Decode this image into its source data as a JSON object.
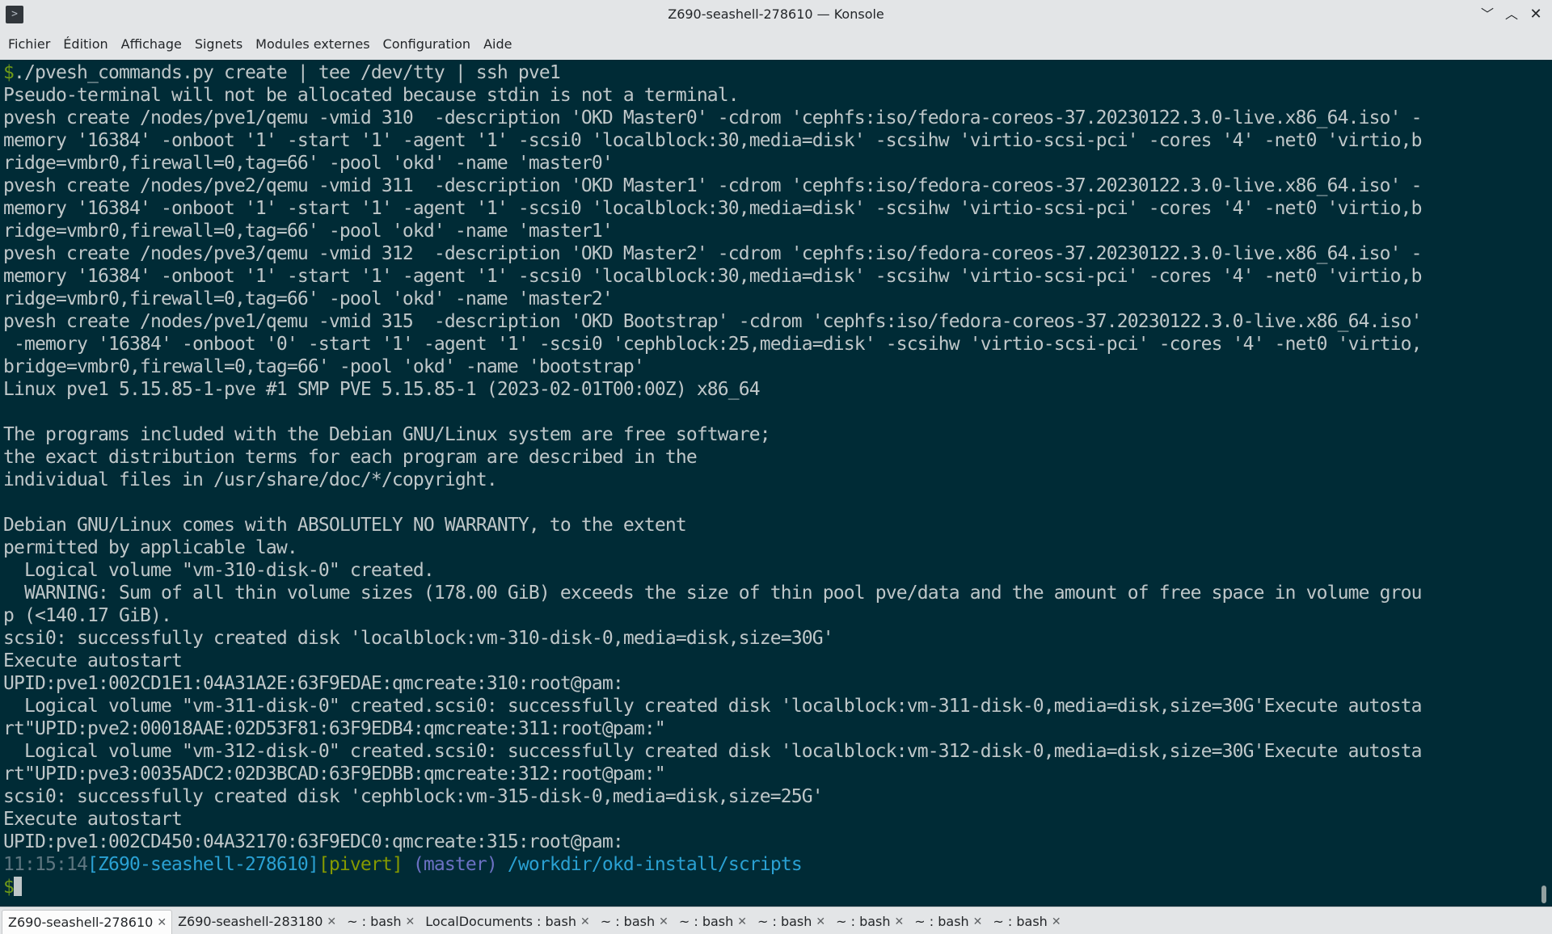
{
  "window": {
    "title": "Z690-seashell-278610 — Konsole",
    "app_icon": ">",
    "minimize_icon": "﹀",
    "maximize_icon": "︿",
    "close_icon": "✕"
  },
  "menu": [
    "Fichier",
    "Édition",
    "Affichage",
    "Signets",
    "Modules externes",
    "Configuration",
    "Aide"
  ],
  "terminal": {
    "lines": [
      [
        {
          "t": "$",
          "c": "c-green"
        },
        {
          "t": "./pvesh_commands.py create | tee /dev/tty | ssh pve1"
        }
      ],
      [
        {
          "t": "Pseudo-terminal will not be allocated because stdin is not a terminal."
        }
      ],
      [
        {
          "t": "pvesh create /nodes/pve1/qemu -vmid 310  -description 'OKD Master0' -cdrom 'cephfs:iso/fedora-coreos-37.20230122.3.0-live.x86_64.iso' -"
        }
      ],
      [
        {
          "t": "memory '16384' -onboot '1' -start '1' -agent '1' -scsi0 'localblock:30,media=disk' -scsihw 'virtio-scsi-pci' -cores '4' -net0 'virtio,b"
        }
      ],
      [
        {
          "t": "ridge=vmbr0,firewall=0,tag=66' -pool 'okd' -name 'master0'"
        }
      ],
      [
        {
          "t": "pvesh create /nodes/pve2/qemu -vmid 311  -description 'OKD Master1' -cdrom 'cephfs:iso/fedora-coreos-37.20230122.3.0-live.x86_64.iso' -"
        }
      ],
      [
        {
          "t": "memory '16384' -onboot '1' -start '1' -agent '1' -scsi0 'localblock:30,media=disk' -scsihw 'virtio-scsi-pci' -cores '4' -net0 'virtio,b"
        }
      ],
      [
        {
          "t": "ridge=vmbr0,firewall=0,tag=66' -pool 'okd' -name 'master1'"
        }
      ],
      [
        {
          "t": "pvesh create /nodes/pve3/qemu -vmid 312  -description 'OKD Master2' -cdrom 'cephfs:iso/fedora-coreos-37.20230122.3.0-live.x86_64.iso' -"
        }
      ],
      [
        {
          "t": "memory '16384' -onboot '1' -start '1' -agent '1' -scsi0 'localblock:30,media=disk' -scsihw 'virtio-scsi-pci' -cores '4' -net0 'virtio,b"
        }
      ],
      [
        {
          "t": "ridge=vmbr0,firewall=0,tag=66' -pool 'okd' -name 'master2'"
        }
      ],
      [
        {
          "t": "pvesh create /nodes/pve1/qemu -vmid 315  -description 'OKD Bootstrap' -cdrom 'cephfs:iso/fedora-coreos-37.20230122.3.0-live.x86_64.iso'"
        }
      ],
      [
        {
          "t": " -memory '16384' -onboot '0' -start '1' -agent '1' -scsi0 'cephblock:25,media=disk' -scsihw 'virtio-scsi-pci' -cores '4' -net0 'virtio,"
        }
      ],
      [
        {
          "t": "bridge=vmbr0,firewall=0,tag=66' -pool 'okd' -name 'bootstrap'"
        }
      ],
      [
        {
          "t": "Linux pve1 5.15.85-1-pve #1 SMP PVE 5.15.85-1 (2023-02-01T00:00Z) x86_64"
        }
      ],
      [
        {
          "t": ""
        }
      ],
      [
        {
          "t": "The programs included with the Debian GNU/Linux system are free software;"
        }
      ],
      [
        {
          "t": "the exact distribution terms for each program are described in the"
        }
      ],
      [
        {
          "t": "individual files in /usr/share/doc/*/copyright."
        }
      ],
      [
        {
          "t": ""
        }
      ],
      [
        {
          "t": "Debian GNU/Linux comes with ABSOLUTELY NO WARRANTY, to the extent"
        }
      ],
      [
        {
          "t": "permitted by applicable law."
        }
      ],
      [
        {
          "t": "  Logical volume \"vm-310-disk-0\" created."
        }
      ],
      [
        {
          "t": "  WARNING: Sum of all thin volume sizes (178.00 GiB) exceeds the size of thin pool pve/data and the amount of free space in volume grou"
        }
      ],
      [
        {
          "t": "p (<140.17 GiB)."
        }
      ],
      [
        {
          "t": "scsi0: successfully created disk 'localblock:vm-310-disk-0,media=disk,size=30G'"
        }
      ],
      [
        {
          "t": "Execute autostart"
        }
      ],
      [
        {
          "t": "UPID:pve1:002CD1E1:04A31A2E:63F9EDAE:qmcreate:310:root@pam:"
        }
      ],
      [
        {
          "t": "  Logical volume \"vm-311-disk-0\" created.scsi0: successfully created disk 'localblock:vm-311-disk-0,media=disk,size=30G'Execute autosta"
        }
      ],
      [
        {
          "t": "rt\"UPID:pve2:00018AAE:02D53F81:63F9EDB4:qmcreate:311:root@pam:\""
        }
      ],
      [
        {
          "t": "  Logical volume \"vm-312-disk-0\" created.scsi0: successfully created disk 'localblock:vm-312-disk-0,media=disk,size=30G'Execute autosta"
        }
      ],
      [
        {
          "t": "rt\"UPID:pve3:0035ADC2:02D3BCAD:63F9EDBB:qmcreate:312:root@pam:\""
        }
      ],
      [
        {
          "t": "scsi0: successfully created disk 'cephblock:vm-315-disk-0,media=disk,size=25G'"
        }
      ],
      [
        {
          "t": "Execute autostart"
        }
      ],
      [
        {
          "t": "UPID:pve1:002CD450:04A32170:63F9EDC0:qmcreate:315:root@pam:"
        }
      ],
      [
        {
          "t": "11:15:14",
          "c": "c-grey"
        },
        {
          "t": "[Z690-seashell-278610]",
          "c": "c-cyan"
        },
        {
          "t": "[pivert]",
          "c": "c-olive"
        },
        {
          "t": " (master)",
          "c": "c-violet"
        },
        {
          "t": " /workdir/okd-install/scripts",
          "c": "c-cyan"
        }
      ],
      [
        {
          "t": "$",
          "c": "c-green"
        }
      ]
    ]
  },
  "tabs": [
    {
      "label": "Z690-seashell-278610",
      "active": true
    },
    {
      "label": "Z690-seashell-283180",
      "active": false
    },
    {
      "label": "~ : bash",
      "active": false
    },
    {
      "label": "LocalDocuments : bash",
      "active": false
    },
    {
      "label": "~ : bash",
      "active": false
    },
    {
      "label": "~ : bash",
      "active": false
    },
    {
      "label": "~ : bash",
      "active": false
    },
    {
      "label": "~ : bash",
      "active": false
    },
    {
      "label": "~ : bash",
      "active": false
    },
    {
      "label": "~ : bash",
      "active": false
    }
  ],
  "tab_close_icon": "✕",
  "colors": {
    "terminal_bg": "#002b36",
    "terminal_fg": "#bfc7c9",
    "prompt_green": "#6f9b18",
    "prompt_cyan": "#2aa1d3",
    "chrome_bg": "#e3e5e7"
  }
}
